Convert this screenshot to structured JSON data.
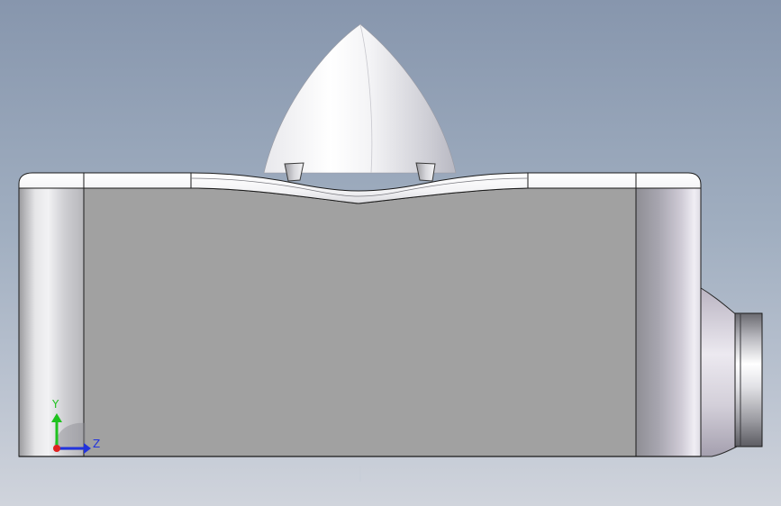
{
  "viewport": {
    "background_top": "#8796ad",
    "background_bottom": "#d0d4dc"
  },
  "model": {
    "body_face_color": "#a1a1a1",
    "edge_color": "#1a1a1a",
    "highlight_color": "#ffffff"
  },
  "triad": {
    "y_label": "Y",
    "z_label": "Z",
    "y_color": "#1fc21f",
    "z_color": "#2233dd",
    "x_color": "#e02020"
  }
}
